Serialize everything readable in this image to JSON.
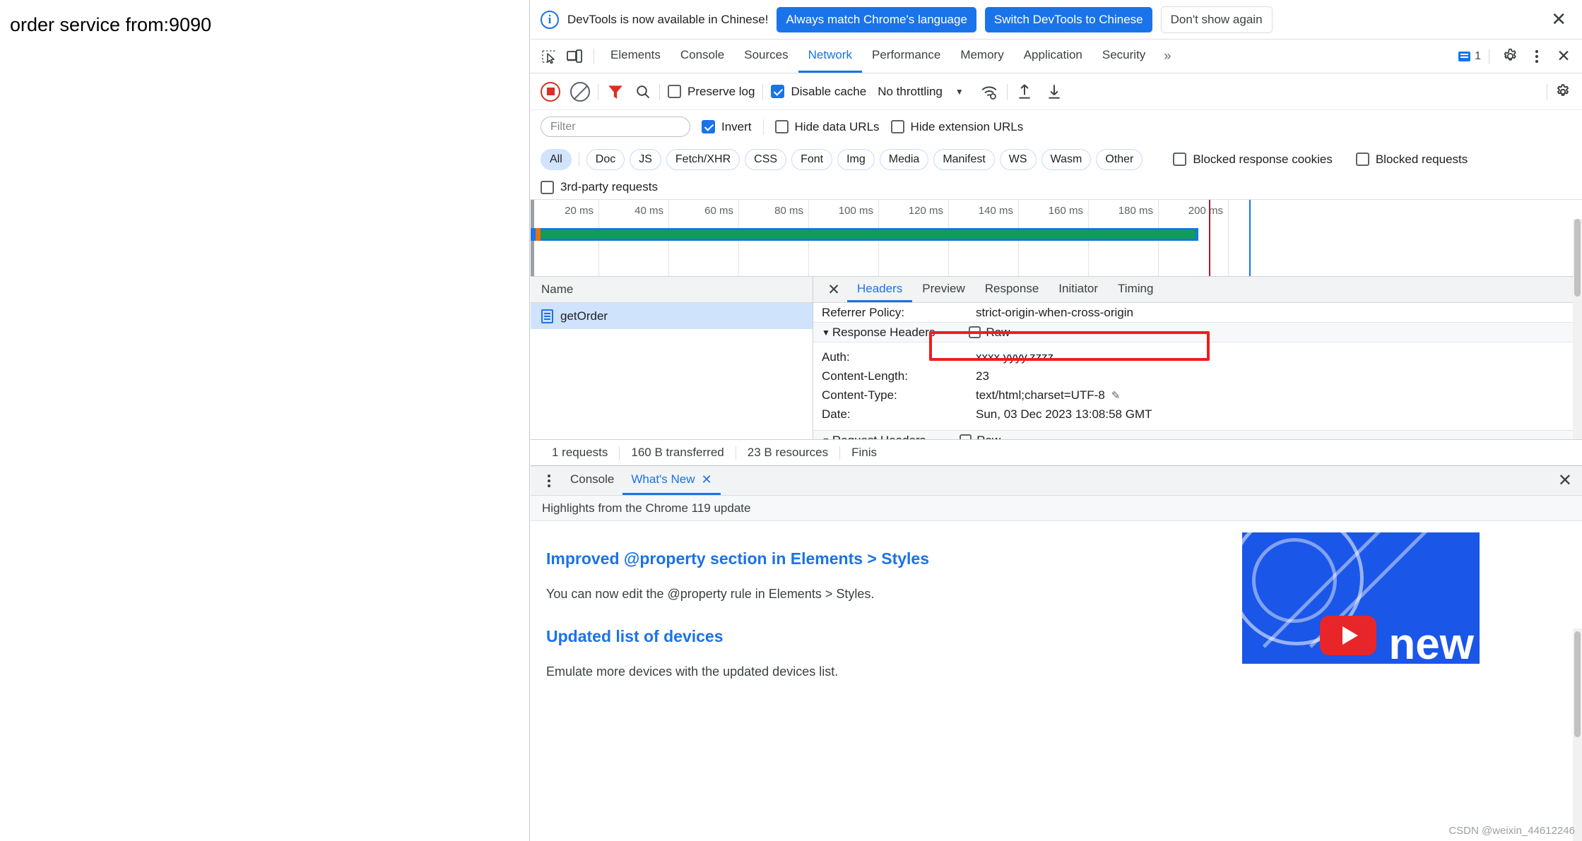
{
  "page": {
    "title": "order service from:9090"
  },
  "banner": {
    "icon": "info-icon",
    "message": "DevTools is now available in Chinese!",
    "primary_button": "Always match Chrome's language",
    "secondary_button": "Switch DevTools to Chinese",
    "dismiss_button": "Don't show again",
    "close_icon": "✕"
  },
  "tabstrip": {
    "inspect_icon": "inspect-element-icon",
    "device_icon": "device-toolbar-icon",
    "tabs": [
      {
        "label": "Elements",
        "selected": false
      },
      {
        "label": "Console",
        "selected": false
      },
      {
        "label": "Sources",
        "selected": false
      },
      {
        "label": "Network",
        "selected": true
      },
      {
        "label": "Performance",
        "selected": false
      },
      {
        "label": "Memory",
        "selected": false
      },
      {
        "label": "Application",
        "selected": false
      },
      {
        "label": "Security",
        "selected": false
      }
    ],
    "more_tabs_icon": "»",
    "message_count": "1",
    "settings_icon": "gear-icon",
    "kebab_icon": "more-options-icon",
    "close_icon": "✕"
  },
  "network_toolbar": {
    "record_icon": "record-stop-icon",
    "clear_icon": "clear-icon",
    "filter_icon": "filter-funnel-icon",
    "search_icon": "search-icon",
    "preserve_log": {
      "label": "Preserve log",
      "checked": false
    },
    "disable_cache": {
      "label": "Disable cache",
      "checked": true
    },
    "throttling": "No throttling",
    "throttling_caret": "▼",
    "wifi_icon": "network-conditions-icon",
    "import_icon": "import-har-icon",
    "export_icon": "export-har-icon",
    "settings_icon": "network-settings-gear-icon"
  },
  "filter_row": {
    "placeholder": "Filter",
    "value": "",
    "invert": {
      "label": "Invert",
      "checked": true
    },
    "hide_data_urls": {
      "label": "Hide data URLs",
      "checked": false
    },
    "hide_extension_urls": {
      "label": "Hide extension URLs",
      "checked": false
    }
  },
  "type_chips": [
    {
      "label": "All",
      "selected": true
    },
    {
      "label": "Doc",
      "selected": false
    },
    {
      "label": "JS",
      "selected": false
    },
    {
      "label": "Fetch/XHR",
      "selected": false
    },
    {
      "label": "CSS",
      "selected": false
    },
    {
      "label": "Font",
      "selected": false
    },
    {
      "label": "Img",
      "selected": false
    },
    {
      "label": "Media",
      "selected": false
    },
    {
      "label": "Manifest",
      "selected": false
    },
    {
      "label": "WS",
      "selected": false
    },
    {
      "label": "Wasm",
      "selected": false
    },
    {
      "label": "Other",
      "selected": false
    }
  ],
  "chip_row_checkboxes": [
    {
      "label": "Blocked response cookies",
      "checked": false
    },
    {
      "label": "Blocked requests",
      "checked": false
    }
  ],
  "third_party": {
    "label": "3rd-party requests",
    "checked": false
  },
  "overview": {
    "ticks": [
      "20 ms",
      "40 ms",
      "60 ms",
      "80 ms",
      "100 ms",
      "120 ms",
      "140 ms",
      "160 ms",
      "180 ms",
      "200 ms"
    ]
  },
  "request_list": {
    "column_header": "Name",
    "rows": [
      {
        "name": "getOrder",
        "icon": "document-icon",
        "selected": true
      }
    ]
  },
  "details": {
    "close_icon": "✕",
    "tabs": [
      {
        "label": "Headers",
        "selected": true
      },
      {
        "label": "Preview",
        "selected": false
      },
      {
        "label": "Response",
        "selected": false
      },
      {
        "label": "Initiator",
        "selected": false
      },
      {
        "label": "Timing",
        "selected": false
      }
    ],
    "top_header": {
      "key": "Referrer Policy:",
      "value": "strict-origin-when-cross-origin"
    },
    "response_headers": {
      "title": "Response Headers",
      "raw_label": "Raw",
      "raw_checked": false,
      "items": [
        {
          "key": "Auth:",
          "value": "xxxx.yyyy.zzzz",
          "highlighted": true
        },
        {
          "key": "Content-Length:",
          "value": "23",
          "highlighted": false
        },
        {
          "key": "Content-Type:",
          "value": "text/html;charset=UTF-8",
          "highlighted": false,
          "editable": true
        },
        {
          "key": "Date:",
          "value": "Sun, 03 Dec 2023 13:08:58 GMT",
          "highlighted": false
        }
      ]
    },
    "request_headers": {
      "title": "Request Headers",
      "raw_label": "Raw",
      "raw_checked": false
    },
    "highlight_color": "#f01d1d"
  },
  "status_bar": {
    "requests": "1 requests",
    "transferred": "160 B transferred",
    "resources": "23 B resources",
    "finish": "Finis"
  },
  "drawer": {
    "kebab_icon": "drawer-more-options-icon",
    "tabs": [
      {
        "label": "Console",
        "selected": false,
        "closable": false
      },
      {
        "label": "What's New",
        "selected": true,
        "closable": true,
        "close_icon": "✕"
      }
    ],
    "close_icon": "✕",
    "subheader": "Highlights from the Chrome 119 update",
    "entries": [
      {
        "heading": "Improved @property section in Elements > Styles",
        "body": "You can now edit the @property rule in Elements > Styles."
      },
      {
        "heading": "Updated list of devices",
        "body": "Emulate more devices with the updated devices list."
      }
    ],
    "thumbnail_label": "new",
    "thumbnail_play_icon": "play-icon"
  },
  "watermark": "CSDN @weixin_44612246"
}
